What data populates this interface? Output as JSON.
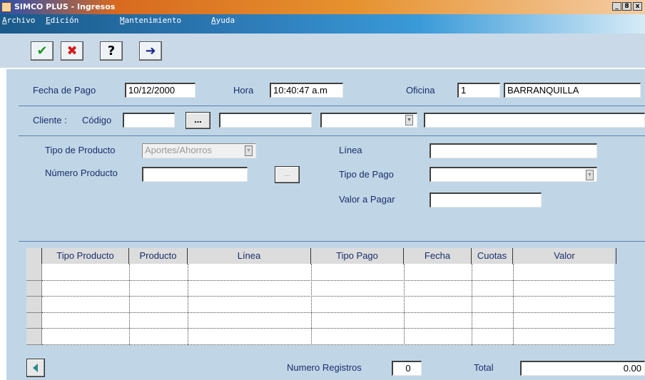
{
  "window": {
    "title": "SIMCO PLUS - Ingresos",
    "app_icon": "app-icon",
    "controls": [
      "_",
      "8",
      "x"
    ]
  },
  "menu": {
    "items": [
      "Archivo",
      "Edición",
      "Mantenimiento",
      "Ayuda"
    ]
  },
  "toolbar": {
    "buttons": [
      {
        "name": "accept-button",
        "icon": "check-icon",
        "glyph": "✔",
        "color": "#1e9a1e"
      },
      {
        "name": "cancel-button",
        "icon": "close-icon",
        "glyph": "✖",
        "color": "#d81818"
      },
      {
        "name": "help-button",
        "icon": "help-icon",
        "glyph": "?",
        "color": "#000000"
      },
      {
        "name": "exit-button",
        "icon": "exit-door-icon",
        "glyph": "➜",
        "color": "#1a2a8a"
      }
    ]
  },
  "header": {
    "fecha_label": "Fecha de Pago",
    "fecha_value": "10/12/2000",
    "hora_label": "Hora",
    "hora_value": "10:40:47 a.m",
    "oficina_label": "Oficina",
    "oficina_code": "1",
    "oficina_name": "BARRANQUILLA"
  },
  "cliente": {
    "label": "Cliente :",
    "codigo_label": "Código",
    "codigo_value": "",
    "lookup_label": "...",
    "nombre_value": "",
    "tipo_value": "",
    "extra_value": ""
  },
  "producto": {
    "tipo_label": "Tipo de Producto",
    "tipo_value": "Aportes/Ahorros",
    "numero_label": "Número Producto",
    "numero_value": "",
    "lookup_label": "...",
    "linea_label": "Línea",
    "linea_value": "",
    "tipo_pago_label": "Tipo de Pago",
    "tipo_pago_value": "",
    "valor_label": "Valor a Pagar",
    "valor_value": ""
  },
  "table": {
    "columns": [
      "Tipo Producto",
      "Producto",
      "Línea",
      "Tipo Pago",
      "Fecha",
      "Cuotas",
      "Valor"
    ],
    "rows": [
      [
        "",
        "",
        "",
        "",
        "",
        "",
        ""
      ],
      [
        "",
        "",
        "",
        "",
        "",
        "",
        ""
      ],
      [
        "",
        "",
        "",
        "",
        "",
        "",
        ""
      ],
      [
        "",
        "",
        "",
        "",
        "",
        "",
        ""
      ],
      [
        "",
        "",
        "",
        "",
        "",
        "",
        ""
      ]
    ]
  },
  "footer": {
    "nav_icon": "arrow-left-icon",
    "registros_label": "Numero Registros",
    "registros_value": "0",
    "total_label": "Total",
    "total_value": "0.00"
  },
  "colors": {
    "panel": "#c0d6e6",
    "toolbar": "#c9d9e8",
    "label_text": "#1a2d6b",
    "nav_arrow": "#2a8a8a"
  }
}
